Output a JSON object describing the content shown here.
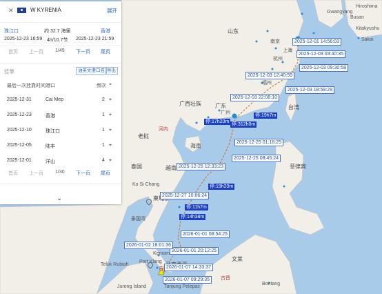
{
  "vessel": {
    "name": "W KYRENIA",
    "expand_label": "展开"
  },
  "voyage": {
    "from_port": "珠江口",
    "to_port": "香港",
    "distance": "约 32.7 海里",
    "duration_speed": "4h/10.7节",
    "from_time": "2025-12-23 16:59",
    "to_time": "2025-12-23 21:59"
  },
  "pager_top": {
    "first": "首页",
    "prev": "上一页",
    "current": "1/49",
    "next": "下一页",
    "last": "尾页"
  },
  "port_section": {
    "title": "挂靠",
    "btn_export_a": "油英文港口名",
    "btn_export_b": "导出",
    "col_time": "最后一次挂靠时间",
    "col_port": "港口",
    "col_count": "频次",
    "rows": [
      {
        "time": "2025-12-31",
        "port": "Cai Mep",
        "count": "2"
      },
      {
        "time": "2025-12-23",
        "port": "香港",
        "count": "1"
      },
      {
        "time": "2025-12-10",
        "port": "珠江口",
        "count": "1"
      },
      {
        "time": "2025-12-05",
        "port": "陆丰",
        "count": "1"
      },
      {
        "time": "2025-12-01",
        "port": "洋山",
        "count": "4"
      }
    ]
  },
  "pager_bottom": {
    "first": "首页",
    "prev": "上一页",
    "current": "1/30",
    "next": "下一页",
    "last": "尾页"
  },
  "track_labels": [
    "2025-12-01 14:56:03",
    "2025-12-03 03:40:35",
    "2025-12-03 09:30:58",
    "2025-12-03 12:40:59",
    "2025-12-03 18:59:28",
    "2025-12-03 22:08:10",
    "2025-12-25 01:18:25",
    "2025-12-25 08:45:24",
    "2025-12-25 12:33:23",
    "2025-12-27 10:06:24",
    "2026-01-01 08:54:25",
    "2026-01-01 20:12:25",
    "2026-01-02 18:01:36",
    "2026-01-07 14:33:37",
    "2026-01-07 09:29:35"
  ],
  "stay_labels": [
    "停:19h7m",
    "停:17h20m",
    "停:312h0m",
    "停:19h20m",
    "停:11h7m",
    "停:14h38m"
  ],
  "map_labels": {
    "shandong": "山东",
    "nanjing": "南京",
    "shanghai": "上海",
    "hangzhou": "杭州",
    "fujian": "福州",
    "taiwan": "台湾",
    "guangdong": "广东",
    "guangzhou": "广州",
    "guangxi": "广西壮族",
    "hainan": "海南",
    "hanoi": "河内",
    "vietnam": "越南",
    "laos": "老挝",
    "thailand": "泰国",
    "cambodia": "柬埔寨",
    "philippines": "菲律宾",
    "gwangyang": "Gwangyang",
    "busan": "Busan",
    "hiroshima": "Hiroshima",
    "kitakyushu": "Kitakyushu",
    "sakai": "Sakai",
    "kosichang": "Ko Si Chang",
    "kemaman": "Kemaman",
    "portklang": "Port Klang",
    "telukrubiah": "Teluk Rubiah",
    "kualalumpur": "吉隆坡",
    "malaysia": "马来西亚",
    "jurong": "Jurong Island",
    "pelepas": "Tanjung Pelepas",
    "bontang": "Bontang",
    "kuching": "古晋",
    "wenlai": "文莱",
    "gulf": "泰国湾"
  }
}
